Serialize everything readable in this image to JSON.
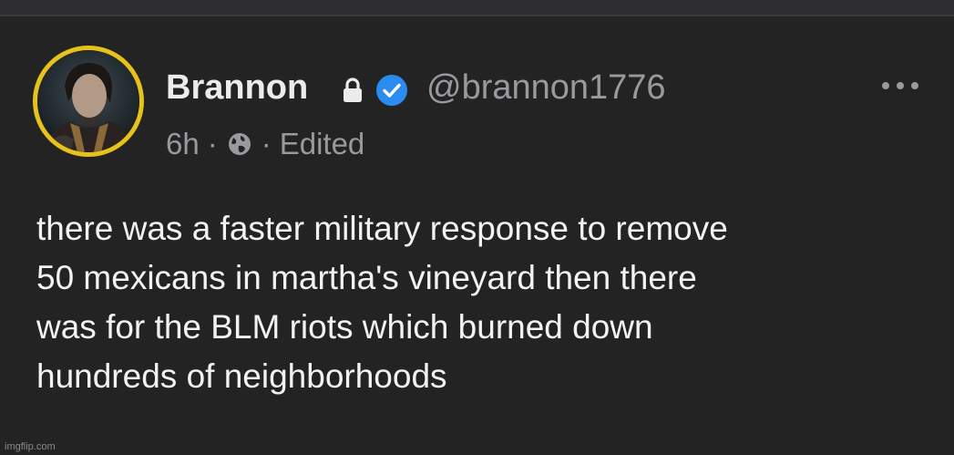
{
  "post": {
    "author": {
      "display_name": "Brannon",
      "handle": "@brannon1776",
      "avatar_icon": "profile-photo",
      "avatar_ring_color": "#e6c21a",
      "locked_icon": "lock-icon",
      "verified_icon": "verified-badge-icon",
      "verified_color": "#2b8cf0"
    },
    "meta": {
      "time": "6h",
      "separator": "·",
      "audience_icon": "globe-icon",
      "edited_label": "Edited"
    },
    "more_icon": "more-options-icon",
    "text": "there was a faster military response to remove\n50 mexicans in martha's vineyard then there\nwas for the BLM riots which burned down\nhundreds of neighborhoods"
  },
  "watermark": "imgflip.com",
  "colors": {
    "background": "#232324",
    "text": "#f2f2f2",
    "muted": "#9a9a9e"
  }
}
